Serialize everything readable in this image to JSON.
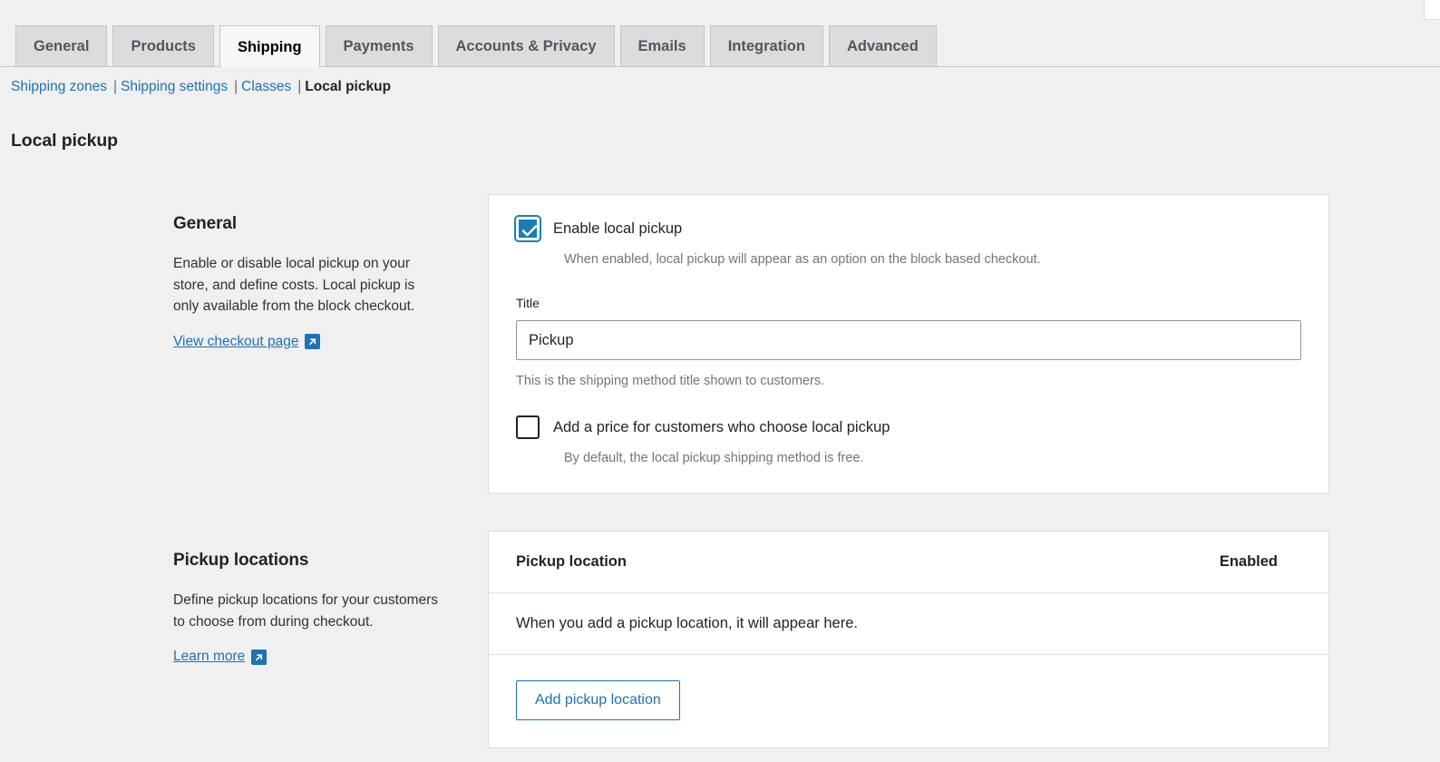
{
  "tabs": [
    {
      "label": "General",
      "active": false
    },
    {
      "label": "Products",
      "active": false
    },
    {
      "label": "Shipping",
      "active": true
    },
    {
      "label": "Payments",
      "active": false
    },
    {
      "label": "Accounts & Privacy",
      "active": false
    },
    {
      "label": "Emails",
      "active": false
    },
    {
      "label": "Integration",
      "active": false
    },
    {
      "label": "Advanced",
      "active": false
    }
  ],
  "subnav": {
    "items": [
      {
        "label": "Shipping zones",
        "current": false
      },
      {
        "label": "Shipping settings",
        "current": false
      },
      {
        "label": "Classes",
        "current": false
      },
      {
        "label": "Local pickup",
        "current": true
      }
    ],
    "separator": "|"
  },
  "page_title": "Local pickup",
  "general": {
    "aside_title": "General",
    "aside_description": "Enable or disable local pickup on your store, and define costs. Local pickup is only available from the block checkout.",
    "aside_link": "View checkout page",
    "aside_link_icon": "external-link-icon",
    "enable_checkbox": {
      "label": "Enable local pickup",
      "checked": true,
      "help": "When enabled, local pickup will appear as an option on the block based checkout."
    },
    "title_field": {
      "label": "Title",
      "value": "Pickup",
      "placeholder": "",
      "description": "This is the shipping method title shown to customers."
    },
    "price_checkbox": {
      "label": "Add a price for customers who choose local pickup",
      "checked": false,
      "help": "By default, the local pickup shipping method is free."
    }
  },
  "pickup_locations": {
    "aside_title": "Pickup locations",
    "aside_description": "Define pickup locations for your customers to choose from during checkout.",
    "aside_link": "Learn more",
    "aside_link_icon": "external-link-icon",
    "table": {
      "columns": [
        "Pickup location",
        "Enabled"
      ],
      "rows": [],
      "empty_message": "When you add a pickup location, it will appear here."
    },
    "add_button": "Add pickup location"
  },
  "colors": {
    "page_background": "#f0f0f1",
    "card_background": "#ffffff",
    "link_blue": "#2271b1",
    "checkbox_blue": "#1c7eb6",
    "border_grey": "#dcdcde",
    "tab_inactive": "#dcdcde",
    "muted_text": "#757575"
  }
}
